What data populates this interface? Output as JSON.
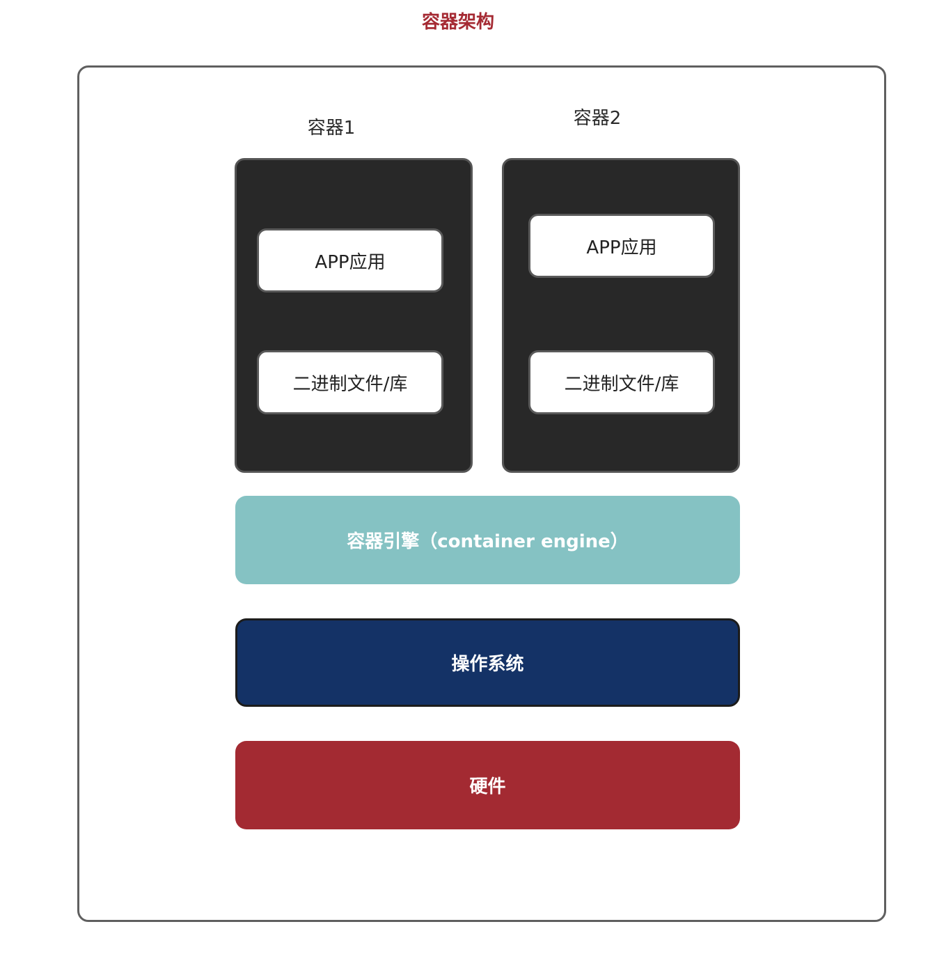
{
  "diagram": {
    "title": "容器架构",
    "containers": [
      {
        "label": "容器1",
        "items": [
          "APP应用",
          "二进制文件/库"
        ]
      },
      {
        "label": "容器2",
        "items": [
          "APP应用",
          "二进制文件/库"
        ]
      }
    ],
    "layers": {
      "engine": "容器引擎（container engine）",
      "os": "操作系统",
      "hardware": "硬件"
    },
    "colors": {
      "title": "#a52a33",
      "container_bg": "#282828",
      "engine_bg": "#85c2c3",
      "os_bg": "#143266",
      "hardware_bg": "#a32a32"
    }
  }
}
